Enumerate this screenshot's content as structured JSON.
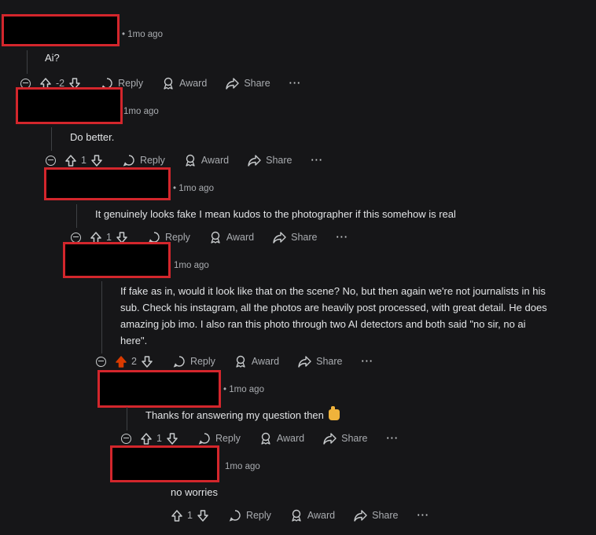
{
  "comments": [
    {
      "time": "• 1mo ago",
      "text": "Ai?",
      "votes": "-2",
      "reply": "Reply",
      "award": "Award",
      "share": "Share",
      "more": "···"
    },
    {
      "time": "1mo ago",
      "text": "Do better.",
      "votes": "1",
      "reply": "Reply",
      "award": "Award",
      "share": "Share",
      "more": "···"
    },
    {
      "time": "• 1mo ago",
      "text": "It genuinely looks fake I mean kudos to the photographer if this somehow is real",
      "votes": "1",
      "reply": "Reply",
      "award": "Award",
      "share": "Share",
      "more": "···"
    },
    {
      "time": "1mo ago",
      "text_lines": [
        "If fake as in, would it look like that on the scene? No, but then again we're not journalists in his",
        "sub. Check his instagram, all the photos are heavily post processed, with great detail. He does",
        "amazing job imo. I also ran this photo through two AI detectors and both said \"no sir, no ai",
        "here\"."
      ],
      "votes": "2",
      "reply": "Reply",
      "award": "Award",
      "share": "Share",
      "more": "···"
    },
    {
      "time": "• 1mo ago",
      "text": "Thanks for answering my question then",
      "votes": "1",
      "reply": "Reply",
      "award": "Award",
      "share": "Share",
      "more": "···"
    },
    {
      "time": "1mo ago",
      "text": "no worries",
      "votes": "1",
      "reply": "Reply",
      "award": "Award",
      "share": "Share",
      "more": "···"
    }
  ],
  "colors": {
    "background": "#161618",
    "redaction_border": "#d3262c",
    "upvote_active": "#d93a00"
  },
  "icons": [
    "collapse-icon",
    "upvote-icon",
    "downvote-icon",
    "reply-icon",
    "award-icon",
    "share-icon",
    "more-icon",
    "thumbs-up-emoji"
  ]
}
